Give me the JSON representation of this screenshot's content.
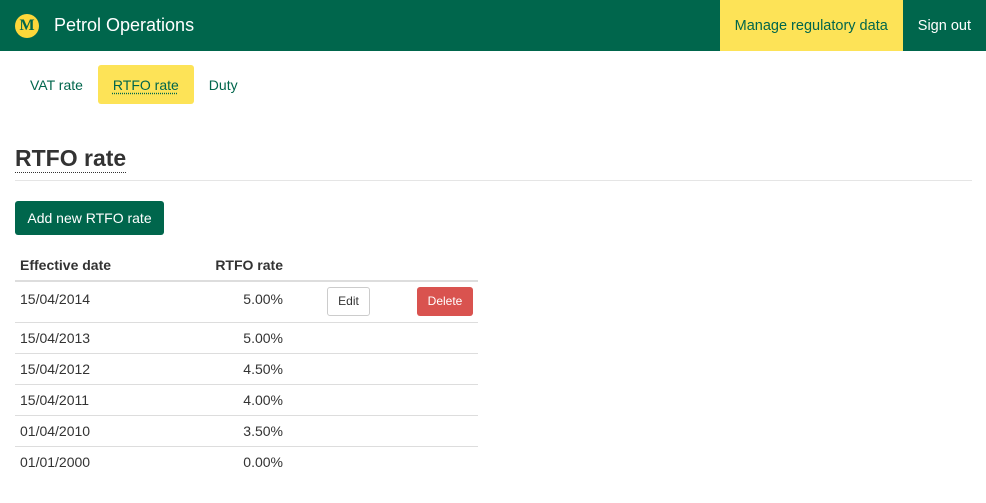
{
  "header": {
    "logo_letter": "M",
    "app_name": "Petrol Operations",
    "nav": [
      {
        "label": "Manage regulatory data",
        "active": true
      },
      {
        "label": "Sign out",
        "active": false
      }
    ]
  },
  "tabs": [
    {
      "label": "VAT rate",
      "active": false
    },
    {
      "label": "RTFO rate",
      "active": true
    },
    {
      "label": "Duty",
      "active": false
    }
  ],
  "page": {
    "title": "RTFO rate",
    "add_button": "Add new RTFO rate"
  },
  "table": {
    "headers": [
      "Effective date",
      "RTFO rate"
    ],
    "actions": {
      "edit": "Edit",
      "delete": "Delete"
    },
    "rows": [
      {
        "date": "15/04/2014",
        "rate": "5.00%"
      },
      {
        "date": "15/04/2013",
        "rate": "5.00%"
      },
      {
        "date": "15/04/2012",
        "rate": "4.50%"
      },
      {
        "date": "15/04/2011",
        "rate": "4.00%"
      },
      {
        "date": "01/04/2010",
        "rate": "3.50%"
      },
      {
        "date": "01/01/2000",
        "rate": "0.00%"
      }
    ]
  },
  "colors": {
    "brand_green": "#00664c",
    "highlight_yellow": "#fde357",
    "delete_red": "#d9534f"
  }
}
